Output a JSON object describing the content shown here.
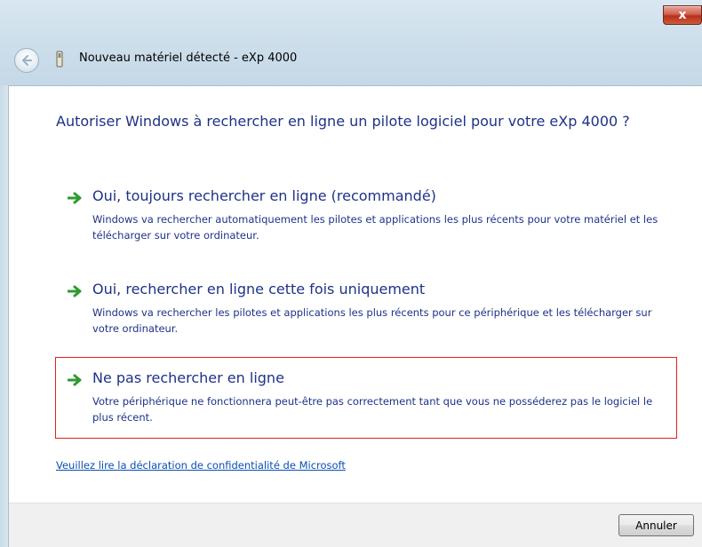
{
  "window": {
    "title": "Nouveau matériel détecté - eXp 4000",
    "close_label": "x"
  },
  "icons": {
    "back": "back-arrow-icon",
    "device": "usb-device-icon",
    "option_arrow": "green-arrow-icon"
  },
  "colors": {
    "heading_text": "#1e3287",
    "link": "#0a4fb0",
    "selected_border": "#e02020",
    "arrow_green": "#2e9a2e"
  },
  "main": {
    "heading": "Autoriser Windows à rechercher en ligne un pilote logiciel pour votre eXp 4000 ?",
    "options": [
      {
        "title": "Oui, toujours rechercher en ligne (recommandé)",
        "description": "Windows va rechercher automatiquement les pilotes et applications les plus récents pour votre matériel et les télécharger sur votre ordinateur."
      },
      {
        "title": "Oui, rechercher en ligne cette fois uniquement",
        "description": "Windows va rechercher les pilotes et applications les plus récents pour ce périphérique et les télécharger sur votre ordinateur."
      },
      {
        "title": "Ne pas rechercher en ligne",
        "description": "Votre périphérique ne fonctionnera peut-être pas correctement tant que vous ne posséderez pas le logiciel le plus récent."
      }
    ],
    "privacy_link": "Veuillez lire la déclaration de confidentialité de Microsoft"
  },
  "footer": {
    "cancel_label": "Annuler"
  }
}
